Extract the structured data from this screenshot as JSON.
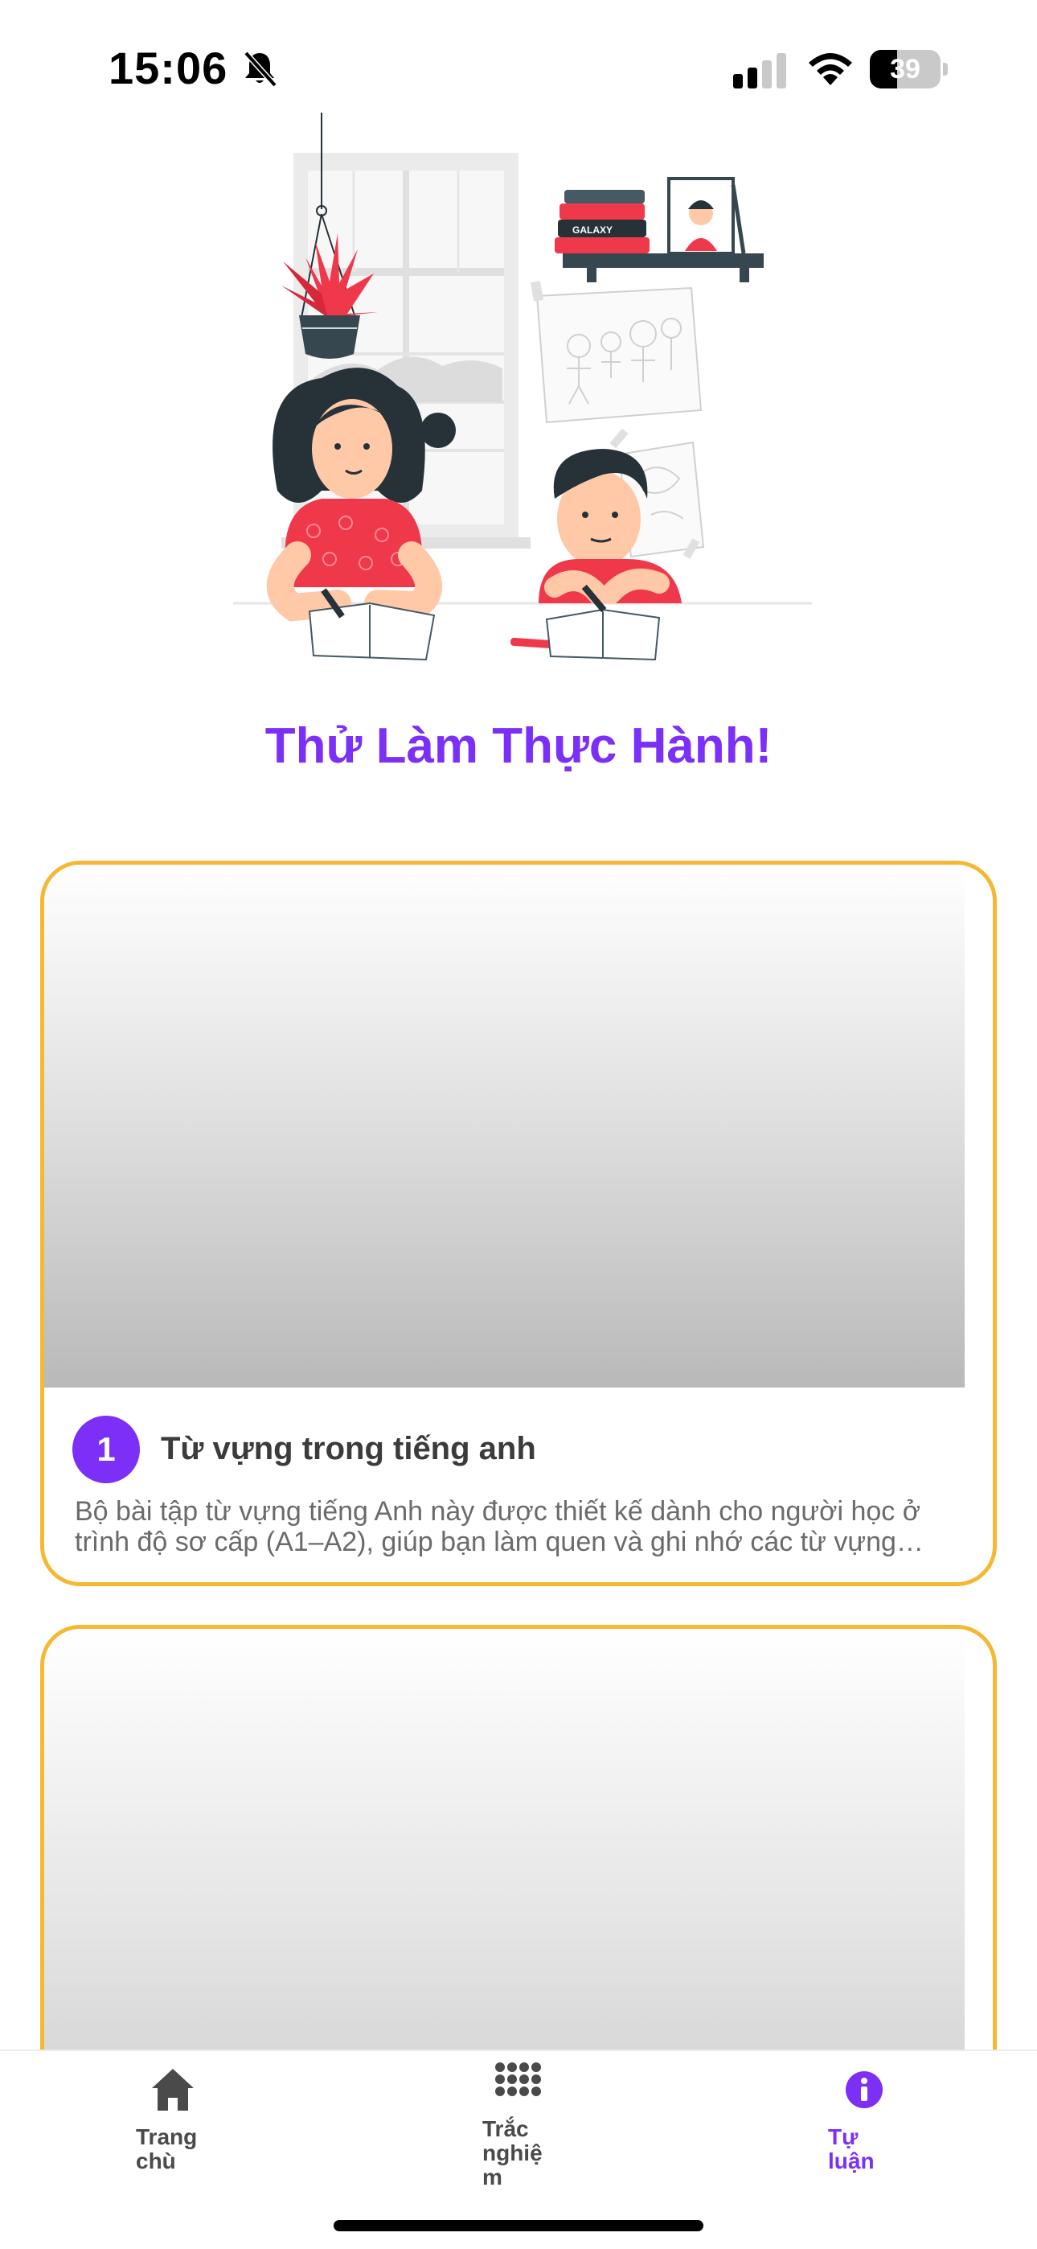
{
  "status_bar": {
    "time": "15:06",
    "battery_level": "39",
    "battery_fraction": 0.39,
    "icons": [
      "bell-slash-icon",
      "cellular-signal-icon",
      "wifi-icon",
      "battery-icon"
    ]
  },
  "hero": {
    "image": "kids-studying-illustration",
    "book_spine_text": "GALAXY"
  },
  "page_title": "Thử Làm Thực Hành!",
  "cards": [
    {
      "number": "1",
      "title": "Từ vựng trong tiếng anh",
      "description": "Bộ bài tập từ vựng tiếng Anh này được thiết kế dành cho người học ở trình độ sơ cấp (A1–A2), giúp bạn làm quen và ghi nhớ các từ vựng thông dụng"
    }
  ],
  "bottom_nav": {
    "items": [
      {
        "label": "Trang\nchù",
        "icon": "home-icon"
      },
      {
        "label": "Trắc\nnghiệ\nm",
        "icon": "grid-dots-icon"
      },
      {
        "label": "Tự\nluận",
        "icon": "info-icon",
        "active": true
      }
    ]
  },
  "colors": {
    "accent": "#7b2ff7",
    "card_border": "#f5b833",
    "text_dark": "#3b3b3b",
    "text_muted": "#6b6b6b"
  }
}
